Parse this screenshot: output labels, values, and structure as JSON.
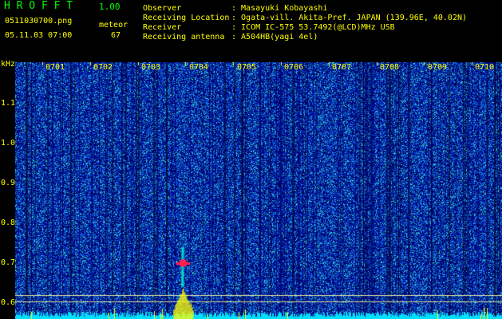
{
  "header": {
    "app_name": "H R O F F T",
    "version": "1.00",
    "filename": "0511030700.png",
    "datetime": "05.11.03 07:00",
    "meteor_label": "meteor",
    "meteor_count": "67"
  },
  "info": [
    {
      "key": "Observer",
      "value": ": Masayuki Kobayashi"
    },
    {
      "key": "Receiving Location",
      "value": ": Ogata-vill. Akita-Pref. JAPAN (139.96E, 40.02N)"
    },
    {
      "key": "Receiver",
      "value": ": ICOM IC-575 53.7492(@LCD)MHz USB"
    },
    {
      "key": "Receiving antenna",
      "value": ": A504HB(yagi 4el)"
    }
  ],
  "colors": {
    "header_green": "#00ff00",
    "info_yellow": "#ffff00",
    "axis_yellow": "#ffff00",
    "background": "#000000",
    "signal_red": "#ff2050",
    "baseline_cyan": "#00e0ff"
  },
  "spectrogram": {
    "y_unit": "kHz",
    "y_ticks": [
      {
        "label": "1.1",
        "value": 1.1
      },
      {
        "label": "1.0",
        "value": 1.0
      },
      {
        "label": "0.9",
        "value": 0.9
      },
      {
        "label": "0.8",
        "value": 0.8
      },
      {
        "label": "0.7",
        "value": 0.7
      },
      {
        "label": "0.6",
        "value": 0.6
      }
    ],
    "time_ticks": [
      "0701",
      "0702",
      "0703",
      "0704",
      "0705",
      "0706",
      "0707",
      "0708",
      "0709",
      "0710"
    ],
    "meteor_echo": {
      "time": "0704",
      "freq_khz": 0.7
    }
  }
}
